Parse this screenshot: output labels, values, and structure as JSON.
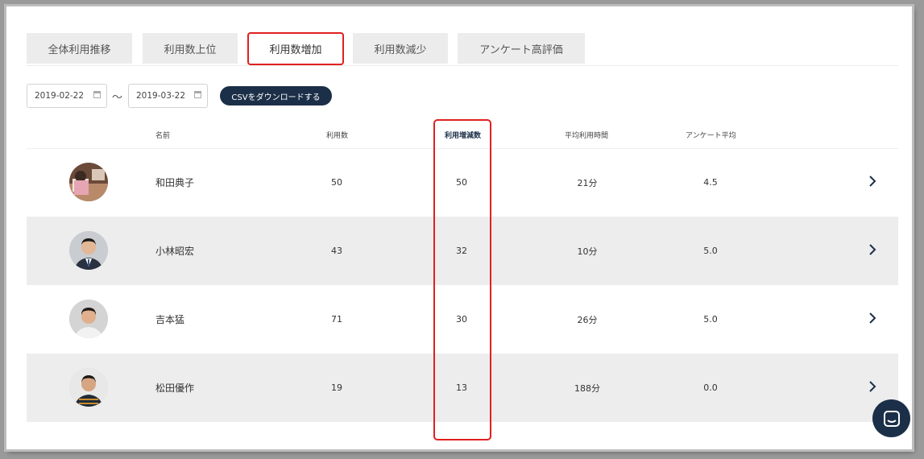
{
  "tabs": [
    {
      "label": "全体利用推移"
    },
    {
      "label": "利用数上位"
    },
    {
      "label": "利用数増加",
      "active": true
    },
    {
      "label": "利用数減少"
    },
    {
      "label": "アンケート高評価"
    }
  ],
  "filters": {
    "start_date": "2019-02-22",
    "end_date": "2019-03-22",
    "separator": "～",
    "csv_button": "CSVをダウンロードする"
  },
  "table": {
    "headers": {
      "name": "名前",
      "usage": "利用数",
      "change": "利用増減数",
      "avg_time": "平均利用時間",
      "survey_avg": "アンケート平均"
    },
    "rows": [
      {
        "name": "和田典子",
        "usage": "50",
        "change": "50",
        "avg_time": "21分",
        "survey_avg": "4.5"
      },
      {
        "name": "小林昭宏",
        "usage": "43",
        "change": "32",
        "avg_time": "10分",
        "survey_avg": "5.0"
      },
      {
        "name": "吉本猛",
        "usage": "71",
        "change": "30",
        "avg_time": "26分",
        "survey_avg": "5.0"
      },
      {
        "name": "松田優作",
        "usage": "19",
        "change": "13",
        "avg_time": "188分",
        "survey_avg": "0.0"
      }
    ]
  },
  "colors": {
    "accent_navy": "#1c2f48",
    "highlight_red": "#e02020",
    "row_shade": "#ededed"
  },
  "icons": {
    "row_action": "chevron-right-icon",
    "date_picker": "calendar-icon",
    "chat": "chat-icon"
  }
}
